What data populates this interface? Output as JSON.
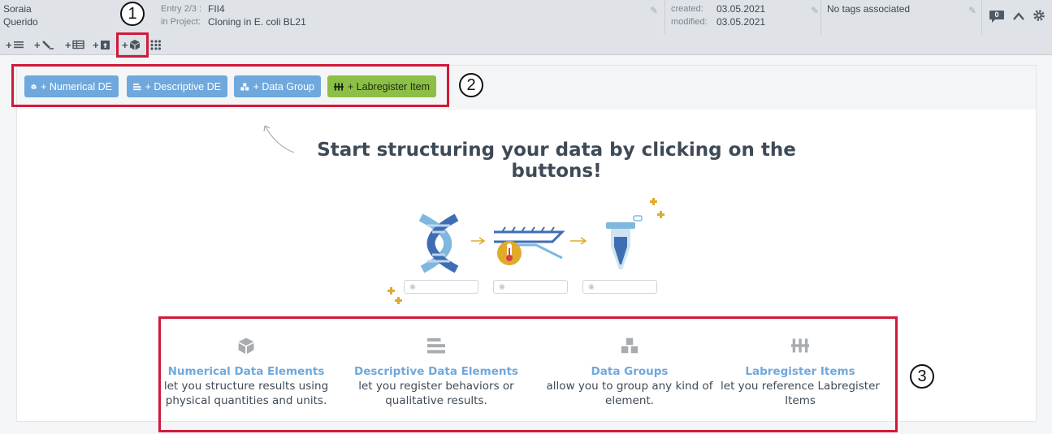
{
  "entry": {
    "author_first": "Soraia",
    "author_last": "Querido",
    "entry_label": "Entry 2/3 :",
    "entry_name": "FII4",
    "project_label": "in Project:",
    "project_name": "Cloning in E. coli BL21",
    "created_label": "created:",
    "created_value": "03.05.2021",
    "modified_label": "modified:",
    "modified_value": "03.05.2021",
    "tags_text": "No tags associated",
    "comment_count": "0"
  },
  "toolbar": {
    "add_text_label": "+",
    "add_sketch_label": "+",
    "add_table_label": "+",
    "add_file_label": "+",
    "add_structured_label": "+"
  },
  "actions": {
    "numerical_label": "+ Numerical DE",
    "descriptive_label": "+ Descriptive DE",
    "group_label": "+ Data Group",
    "labregister_label": "+ Labregister Item"
  },
  "main": {
    "headline": "Start structuring your data by clicking on the buttons!"
  },
  "features": [
    {
      "title": "Numerical Data Elements",
      "desc": "let you structure results using physical quantities and units."
    },
    {
      "title": "Descriptive Data Elements",
      "desc": "let you register behaviors or qualitative results."
    },
    {
      "title": "Data Groups",
      "desc": "allow you to group any kind of element."
    },
    {
      "title": "Labregister Items",
      "desc": "let you reference Labregister Items"
    }
  ],
  "callouts": [
    "1",
    "2",
    "3"
  ],
  "colors": {
    "accent_blue": "#6fa8dc",
    "accent_green": "#8cbf45",
    "highlight_red": "#d1193a"
  }
}
